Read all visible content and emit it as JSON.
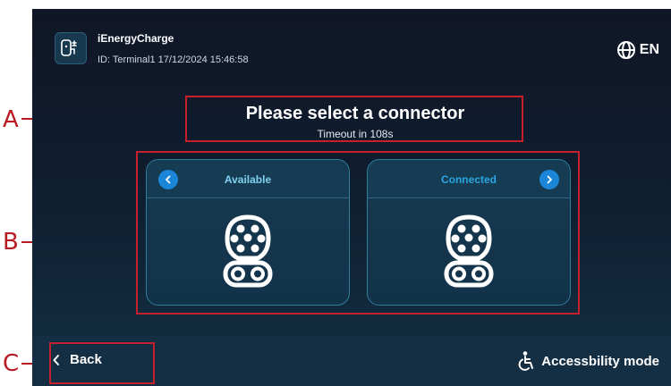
{
  "header": {
    "app_name": "iEnergyCharge",
    "meta": "ID: Terminal1  17/12/2024  15:46:58",
    "language": "EN"
  },
  "main": {
    "title": "Please select a connector",
    "subtitle": "Timeout in 108s",
    "connectors": [
      {
        "status": "Available",
        "status_color": "#7fd2ef"
      },
      {
        "status": "Connected",
        "status_color": "#2aa6e0"
      }
    ]
  },
  "footer": {
    "back_label": "Back",
    "accessibility_label": "Accessbility mode"
  },
  "annotations": {
    "a": "A",
    "b": "B",
    "c": "C",
    "color": "#c5202b"
  },
  "icons": [
    "charger-logo-icon",
    "globe-icon",
    "chevron-left-icon",
    "chevron-right-icon",
    "ev-plug-icon",
    "accessibility-icon"
  ]
}
